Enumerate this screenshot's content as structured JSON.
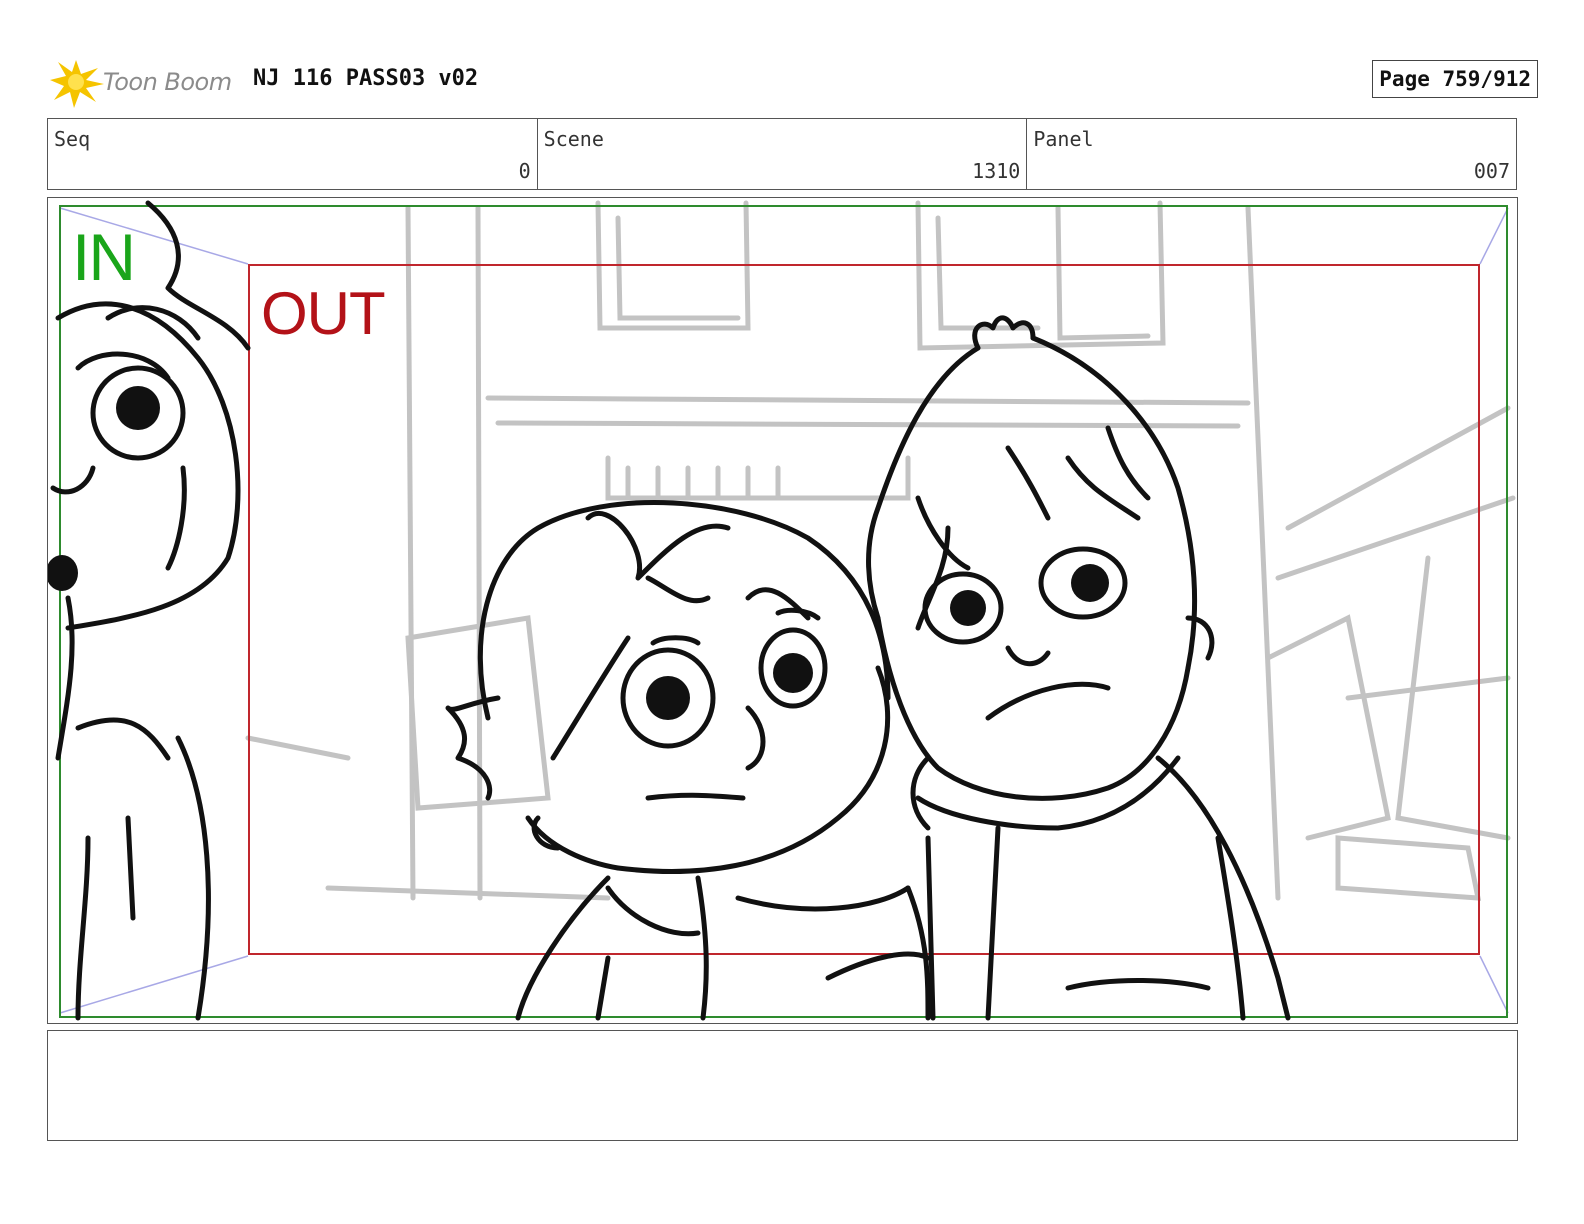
{
  "header": {
    "logo_text": "Toon Boom",
    "title": "NJ 116 PASS03 v02",
    "page": "Page 759/912"
  },
  "meta": {
    "seq_label": "Seq",
    "seq_value": "0",
    "scene_label": "Scene",
    "scene_value": "1310",
    "panel_label": "Panel",
    "panel_value": "007"
  },
  "frame": {
    "in_label": "IN",
    "out_label": "OUT",
    "in_color": "#1aa51a",
    "out_color": "#b31218"
  },
  "notes": {
    "text": ""
  }
}
